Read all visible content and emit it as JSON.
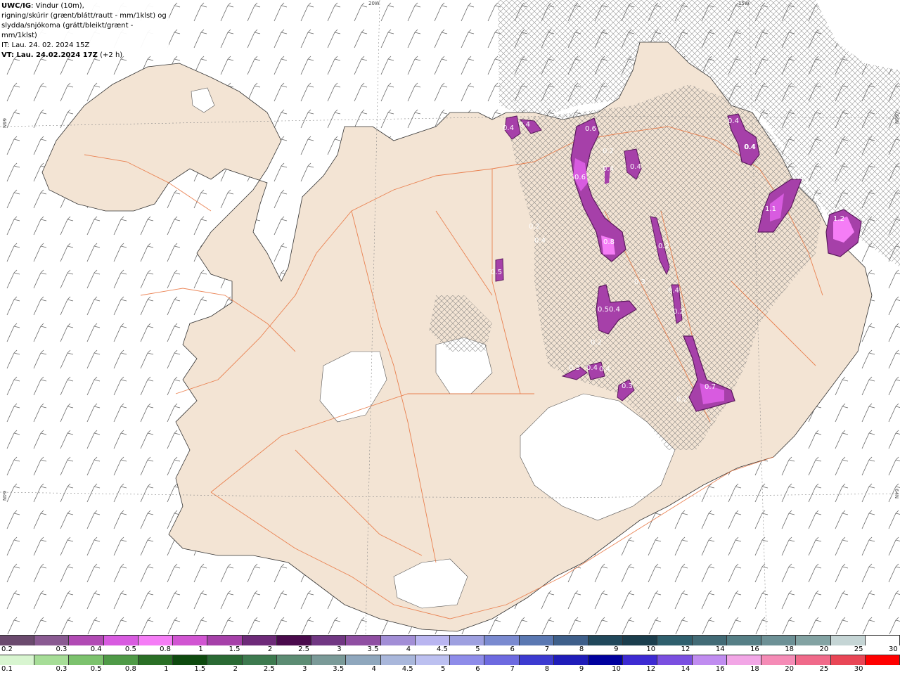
{
  "header": {
    "model": "UWC/IG",
    "line1_rest": ": Vindur (10m),",
    "line2": "rigning/skúrir (grænt/blátt/rautt - mm/1klst) og",
    "line3": "slydda/snjókoma (grátt/bleikt/grænt - mm/1klst)",
    "it_label": "IT: Lau. 24. 02. 2024 15Z",
    "vt_label": "VT: Lau. 24.02.2024 17Z",
    "vt_suffix": " (+2 h)"
  },
  "grid_labels": {
    "lon_20w": "20W",
    "lon_15w": "15W",
    "lat_66n_left": "66N",
    "lat_66n_right": "66N",
    "lat_64n_left": "64N",
    "lat_64n_right": "64N"
  },
  "map_values": [
    "0.4",
    "0.4",
    "0.6",
    "0.4",
    "0.4",
    "0.4",
    "0.6",
    "0.4",
    "1.1",
    "0.6",
    "1.2",
    "0.2",
    "0.4",
    "0.8",
    "0.5",
    "0.3",
    "0.4",
    "0.2",
    "0.5",
    "0.4",
    "0.2",
    "0.3",
    "0.4",
    "0.3",
    "0.7",
    "0.2",
    "0.4",
    "0.2",
    "0.2",
    "0.4"
  ],
  "legend_snow": {
    "labels": [
      "0.2",
      "0.3",
      "0.4",
      "0.5",
      "0.8",
      "1",
      "1.5",
      "2",
      "2.5",
      "3",
      "3.5",
      "4",
      "4.5",
      "5",
      "6",
      "7",
      "8",
      "9",
      "10",
      "12",
      "14",
      "16",
      "18",
      "20",
      "25",
      "30"
    ],
    "colors": [
      "#6b4a6e",
      "#8a5a92",
      "#b14ab4",
      "#d85be0",
      "#f57df6",
      "#d155d2",
      "#a640a9",
      "#6e2a79",
      "#4a0a4c",
      "#713783",
      "#8f4ea2",
      "#a28ed6",
      "#b9b5f0",
      "#9ea0e0",
      "#7a8ad0",
      "#5a78b2",
      "#3e5f8a",
      "#21485b",
      "#1b3e4d",
      "#2f5f6d",
      "#426b76",
      "#567f86",
      "#6d9196",
      "#83a3a3",
      "#c5d5d5",
      "#ffffff"
    ]
  },
  "legend_rain": {
    "labels": [
      "0.1",
      "0.3",
      "0.5",
      "0.8",
      "1",
      "1.5",
      "2",
      "2.5",
      "3",
      "3.5",
      "4",
      "4.5",
      "5",
      "6",
      "7",
      "8",
      "9",
      "10",
      "12",
      "14",
      "16",
      "18",
      "20",
      "25",
      "30"
    ],
    "colors": [
      "#d8f5d0",
      "#a6dd97",
      "#7cc26d",
      "#4f9a47",
      "#2a6f26",
      "#0e4a0f",
      "#2a6a34",
      "#3d7a4f",
      "#5c8c73",
      "#7a9a98",
      "#8fa7bd",
      "#a9b7db",
      "#bcc0f0",
      "#8e8ce9",
      "#6d6ae0",
      "#3c3ad0",
      "#1f1cb9",
      "#00009e",
      "#3d2ad2",
      "#7a4fe0",
      "#c08cf0",
      "#f2a6e6",
      "#f58bb6",
      "#f06a8a",
      "#e94656",
      "#ff0000"
    ]
  }
}
